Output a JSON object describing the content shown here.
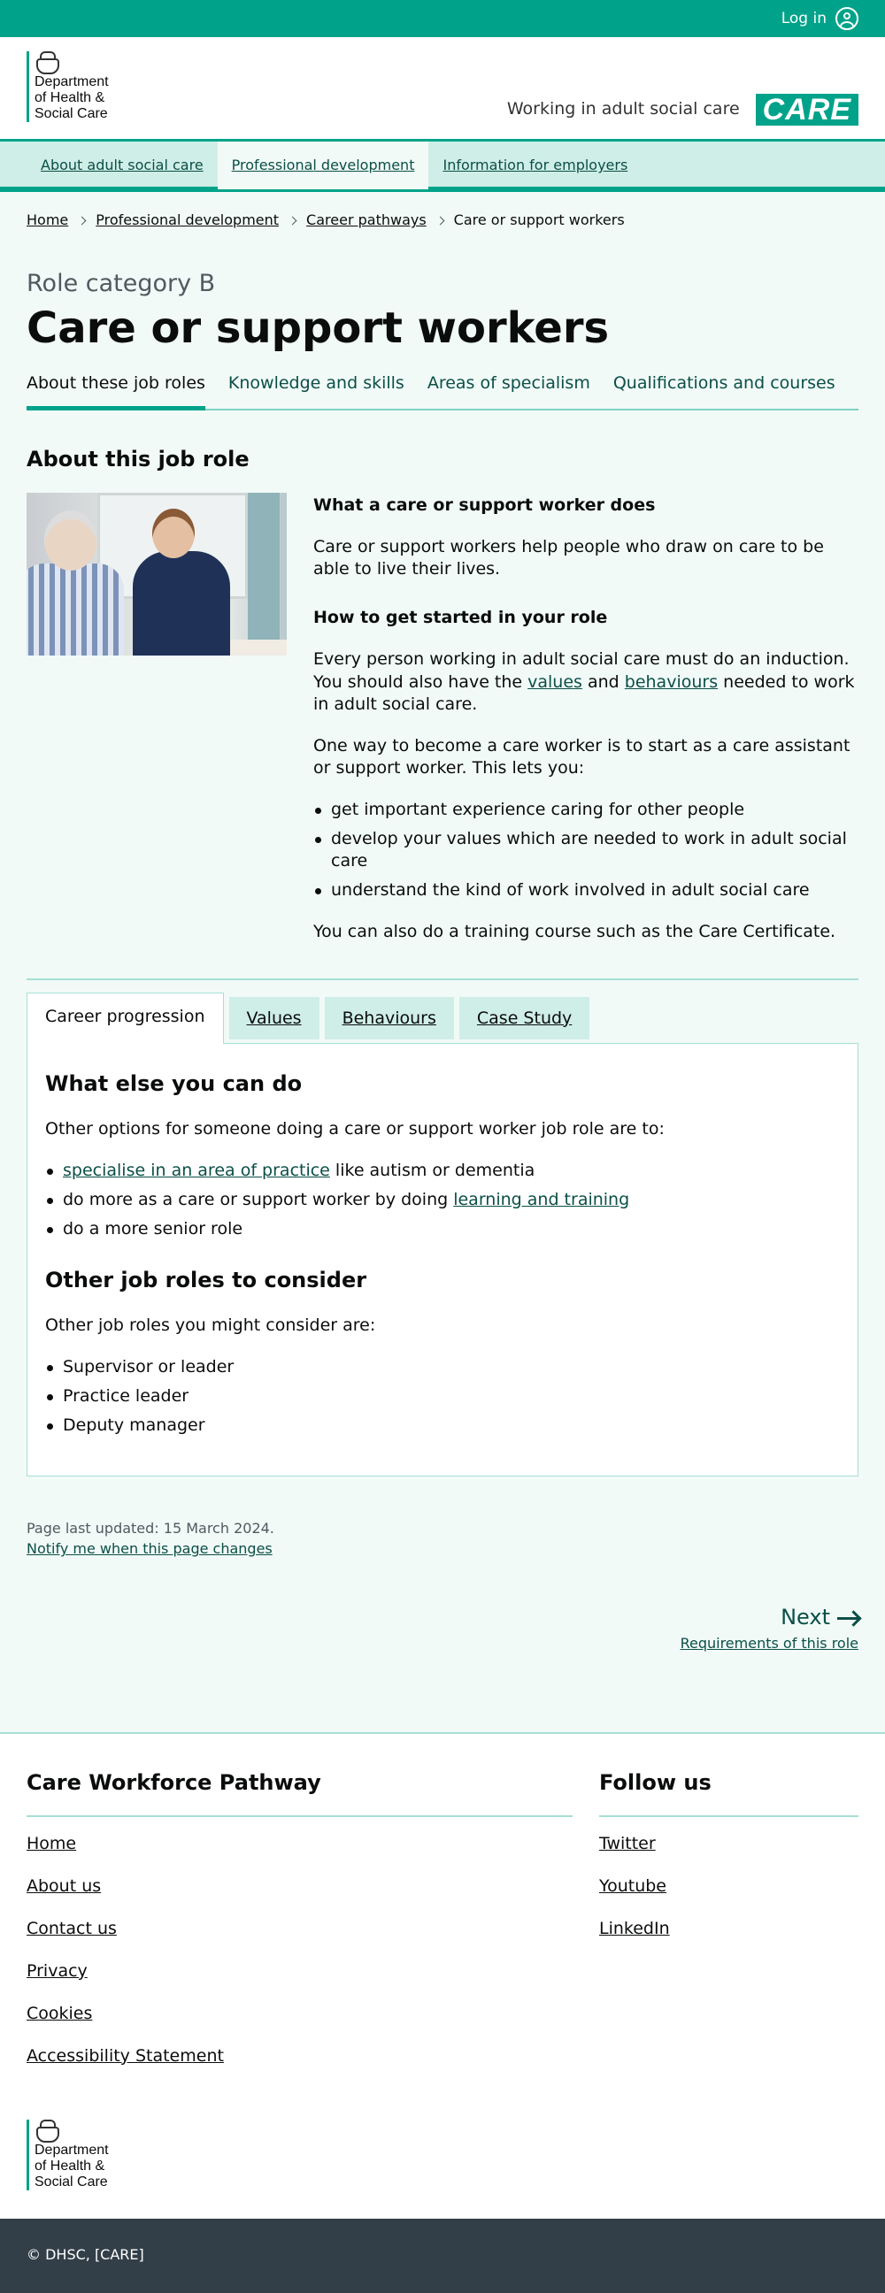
{
  "topbar": {
    "login_label": "Log in"
  },
  "header": {
    "org_name": "Department\nof Health &\nSocial Care",
    "service_name": "Working in adult social care",
    "logo_text": "CARE"
  },
  "nav": {
    "items": [
      {
        "label": "About adult social care"
      },
      {
        "label": "Professional development"
      },
      {
        "label": "Information for employers"
      }
    ]
  },
  "breadcrumbs": [
    {
      "label": "Home"
    },
    {
      "label": "Professional development"
    },
    {
      "label": "Career pathways"
    },
    {
      "label": "Care or support workers"
    }
  ],
  "page": {
    "caption": "Role category B",
    "title": "Care or support workers"
  },
  "subnav": {
    "items": [
      {
        "label": "About these job roles"
      },
      {
        "label": "Knowledge and skills"
      },
      {
        "label": "Areas of specialism"
      },
      {
        "label": "Qualifications and courses"
      }
    ]
  },
  "about": {
    "heading": "About this job role",
    "h_what": "What a care or support worker does",
    "p_what": "Care or support workers help people who draw on care to be able to live their lives.",
    "h_start": "How to get started in your role",
    "p_start_1": "Every person working in adult social care must do an induction. You should also have the ",
    "link_values": "values",
    "p_start_2": " and ",
    "link_behaviours": "behaviours",
    "p_start_3": " needed to work in adult social care.",
    "p_way": "One way to become a care worker is to start as a care assistant or support worker. This lets you:",
    "bullets": [
      "get important experience caring for other people",
      "develop your values which are needed to work in adult social care",
      "understand the kind of work involved in adult social care"
    ],
    "p_course": "You can also do a training course such as the Care Certificate."
  },
  "tabs": {
    "items": [
      {
        "label": "Career progression"
      },
      {
        "label": "Values"
      },
      {
        "label": "Behaviours"
      },
      {
        "label": "Case Study"
      }
    ]
  },
  "panel": {
    "h_else": "What else you can do",
    "p_else": "Other options for someone doing a care or support worker job role are to:",
    "b1_link": "specialise in an area of practice",
    "b1_rest": " like autism or dementia",
    "b2_text": "do more as a care or support worker by doing ",
    "b2_link": "learning and training",
    "b3_text": "do a more senior role",
    "h_other": "Other job roles to consider",
    "p_other": "Other job roles you might consider are:",
    "roles": [
      "Supervisor or leader",
      "Practice leader",
      "Deputy manager"
    ]
  },
  "meta": {
    "updated": "Page last updated: 15 March 2024.",
    "notify": "Notify me when this page changes"
  },
  "next": {
    "label": "Next",
    "sub": "Requirements of this role"
  },
  "footer": {
    "main_heading": "Care Workforce Pathway",
    "main_links": [
      "Home",
      "About us",
      "Contact us",
      "Privacy",
      "Cookies",
      "Accessibility Statement"
    ],
    "side_heading": "Follow us",
    "side_links": [
      "Twitter",
      "Youtube",
      "LinkedIn"
    ],
    "org_name": "Department\nof Health &\nSocial Care",
    "copyright": "© DHSC, [CARE]"
  }
}
